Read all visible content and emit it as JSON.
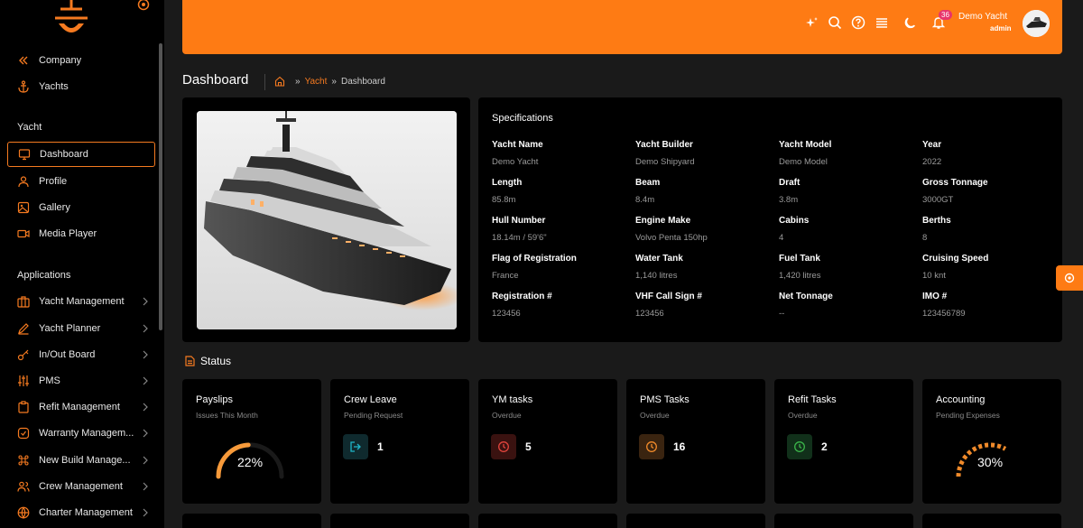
{
  "sidebar": {
    "top_items": [
      {
        "label": "Company",
        "icon": "chevrons-left-icon"
      },
      {
        "label": "Yachts",
        "icon": "anchor-icon"
      }
    ],
    "section_yacht": "Yacht",
    "yacht_items": [
      {
        "label": "Dashboard",
        "icon": "monitor-icon",
        "active": true
      },
      {
        "label": "Profile",
        "icon": "user-icon"
      },
      {
        "label": "Gallery",
        "icon": "image-icon"
      },
      {
        "label": "Media Player",
        "icon": "video-icon"
      }
    ],
    "section_applications": "Applications",
    "app_items": [
      {
        "label": "Yacht Management",
        "icon": "briefcase-icon"
      },
      {
        "label": "Yacht Planner",
        "icon": "pencil-icon"
      },
      {
        "label": "In/Out Board",
        "icon": "key-icon"
      },
      {
        "label": "PMS",
        "icon": "sliders-icon"
      },
      {
        "label": "Refit Management",
        "icon": "clipboard-icon"
      },
      {
        "label": "Warranty Managem...",
        "icon": "shield-check-icon"
      },
      {
        "label": "New Build Manage...",
        "icon": "command-icon"
      },
      {
        "label": "Crew Management",
        "icon": "users-icon"
      },
      {
        "label": "Charter Management",
        "icon": "globe-icon"
      }
    ]
  },
  "header": {
    "notification_count": "36",
    "user_name": "Demo Yacht",
    "user_role": "admin",
    "icons": [
      "sparkle-icon",
      "search-icon",
      "help-icon",
      "menu-icon",
      "moon-icon",
      "bell-icon"
    ]
  },
  "page": {
    "title": "Dashboard",
    "breadcrumb": [
      "Yacht",
      "Dashboard"
    ]
  },
  "specs": {
    "title": "Specifications",
    "fields": [
      {
        "label": "Yacht Name",
        "value": "Demo Yacht"
      },
      {
        "label": "Yacht Builder",
        "value": "Demo Shipyard"
      },
      {
        "label": "Yacht Model",
        "value": "Demo Model"
      },
      {
        "label": "Year",
        "value": "2022"
      },
      {
        "label": "Length",
        "value": "85.8m"
      },
      {
        "label": "Beam",
        "value": "8.4m"
      },
      {
        "label": "Draft",
        "value": "3.8m"
      },
      {
        "label": "Gross Tonnage",
        "value": "3000GT"
      },
      {
        "label": "Hull Number",
        "value": "18.14m / 59'6\""
      },
      {
        "label": "Engine Make",
        "value": "Volvo Penta 150hp"
      },
      {
        "label": "Cabins",
        "value": "4"
      },
      {
        "label": "Berths",
        "value": "8"
      },
      {
        "label": "Flag of Registration",
        "value": "France"
      },
      {
        "label": "Water Tank",
        "value": "1,140 litres"
      },
      {
        "label": "Fuel Tank",
        "value": "1,420 litres"
      },
      {
        "label": "Cruising Speed",
        "value": "10 knt"
      },
      {
        "label": "Registration #",
        "value": "123456"
      },
      {
        "label": "VHF Call Sign #",
        "value": "123456"
      },
      {
        "label": "Net Tonnage",
        "value": "--"
      },
      {
        "label": "IMO #",
        "value": "123456789"
      }
    ]
  },
  "status": {
    "title": "Status",
    "cards": [
      {
        "title": "Payslips",
        "subtitle": "Issues This Month",
        "value": "22%",
        "progress": 0.22,
        "kind": "gauge"
      },
      {
        "title": "Crew Leave",
        "subtitle": "Pending Request",
        "value": "1",
        "icon": "logout-icon",
        "color": "#1fb6c9"
      },
      {
        "title": "YM tasks",
        "subtitle": "Overdue",
        "value": "5",
        "icon": "clock-icon",
        "color": "#e0443c"
      },
      {
        "title": "PMS Tasks",
        "subtitle": "Overdue",
        "value": "16",
        "icon": "clock-icon",
        "color": "#f08a2a"
      },
      {
        "title": "Refit Tasks",
        "subtitle": "Overdue",
        "value": "2",
        "icon": "clock-icon",
        "color": "#3bb54a"
      },
      {
        "title": "Accounting",
        "subtitle": "Pending Expenses",
        "value": "30%",
        "progress": 0.3,
        "kind": "gauge"
      }
    ]
  },
  "colors": {
    "accent": "#fe7b14",
    "background": "#1a1a1a",
    "card": "#000000"
  }
}
